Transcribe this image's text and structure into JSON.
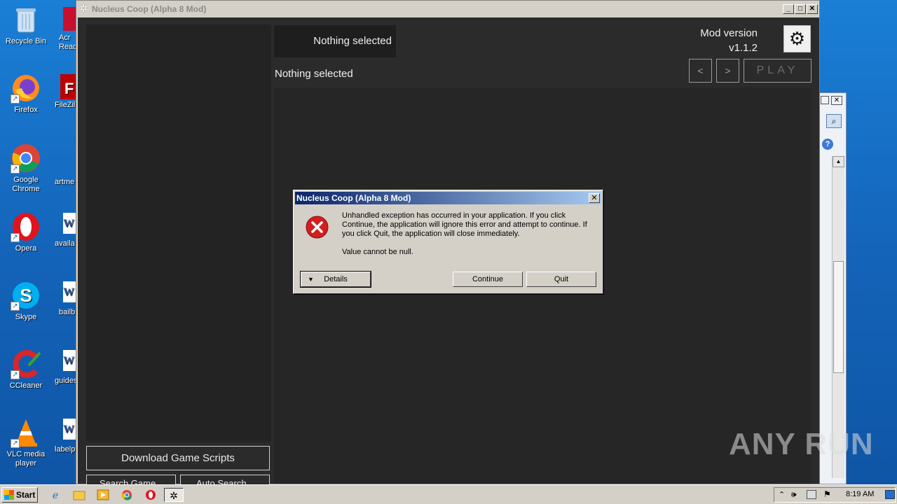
{
  "desktop": {
    "icons": [
      {
        "label": "Recycle Bin",
        "icon": "recycle-bin-icon"
      },
      {
        "label": "Firefox",
        "icon": "firefox-icon"
      },
      {
        "label": "Google Chrome",
        "icon": "chrome-icon"
      },
      {
        "label": "Opera",
        "icon": "opera-icon"
      },
      {
        "label": "Skype",
        "icon": "skype-icon"
      },
      {
        "label": "CCleaner",
        "icon": "ccleaner-icon"
      },
      {
        "label": "VLC media player",
        "icon": "vlc-icon"
      }
    ],
    "partial_icons": [
      {
        "label": "Acr Read",
        "icon": "acrobat-icon"
      },
      {
        "label": "FileZill",
        "icon": "filezilla-icon"
      },
      {
        "label": "artme",
        "icon": "file-icon"
      },
      {
        "label": "availa",
        "icon": "word-doc-icon"
      },
      {
        "label": "bailb",
        "icon": "word-doc-icon"
      },
      {
        "label": "guides",
        "icon": "word-doc-icon"
      },
      {
        "label": "labelp",
        "icon": "word-doc-icon"
      }
    ]
  },
  "window": {
    "title": "Nucleus Coop (Alpha 8 Mod)",
    "controls": {
      "minimize": "_",
      "maximize": "□",
      "close": "✕"
    }
  },
  "app": {
    "selected_box": "Nothing selected",
    "selected_label": "Nothing selected",
    "mod_version_label": "Mod version",
    "mod_version": "v1.1.2",
    "prev_label": "<",
    "next_label": ">",
    "play_label": "PLAY",
    "download_scripts_label": "Download Game Scripts",
    "search_game_label": "Search Game",
    "auto_search_label": "Auto Search"
  },
  "dialog": {
    "title": "Nucleus Coop (Alpha 8 Mod)",
    "close_label": "✕",
    "message": "Unhandled exception has occurred in your application. If you click Continue, the application will ignore this error and attempt to continue. If you click Quit, the application will close immediately.",
    "detail": "Value cannot be null.",
    "details_label": "Details",
    "continue_label": "Continue",
    "quit_label": "Quit"
  },
  "watermark": "ANY RUN",
  "taskbar": {
    "start_label": "Start",
    "clock": "8:19 AM"
  }
}
